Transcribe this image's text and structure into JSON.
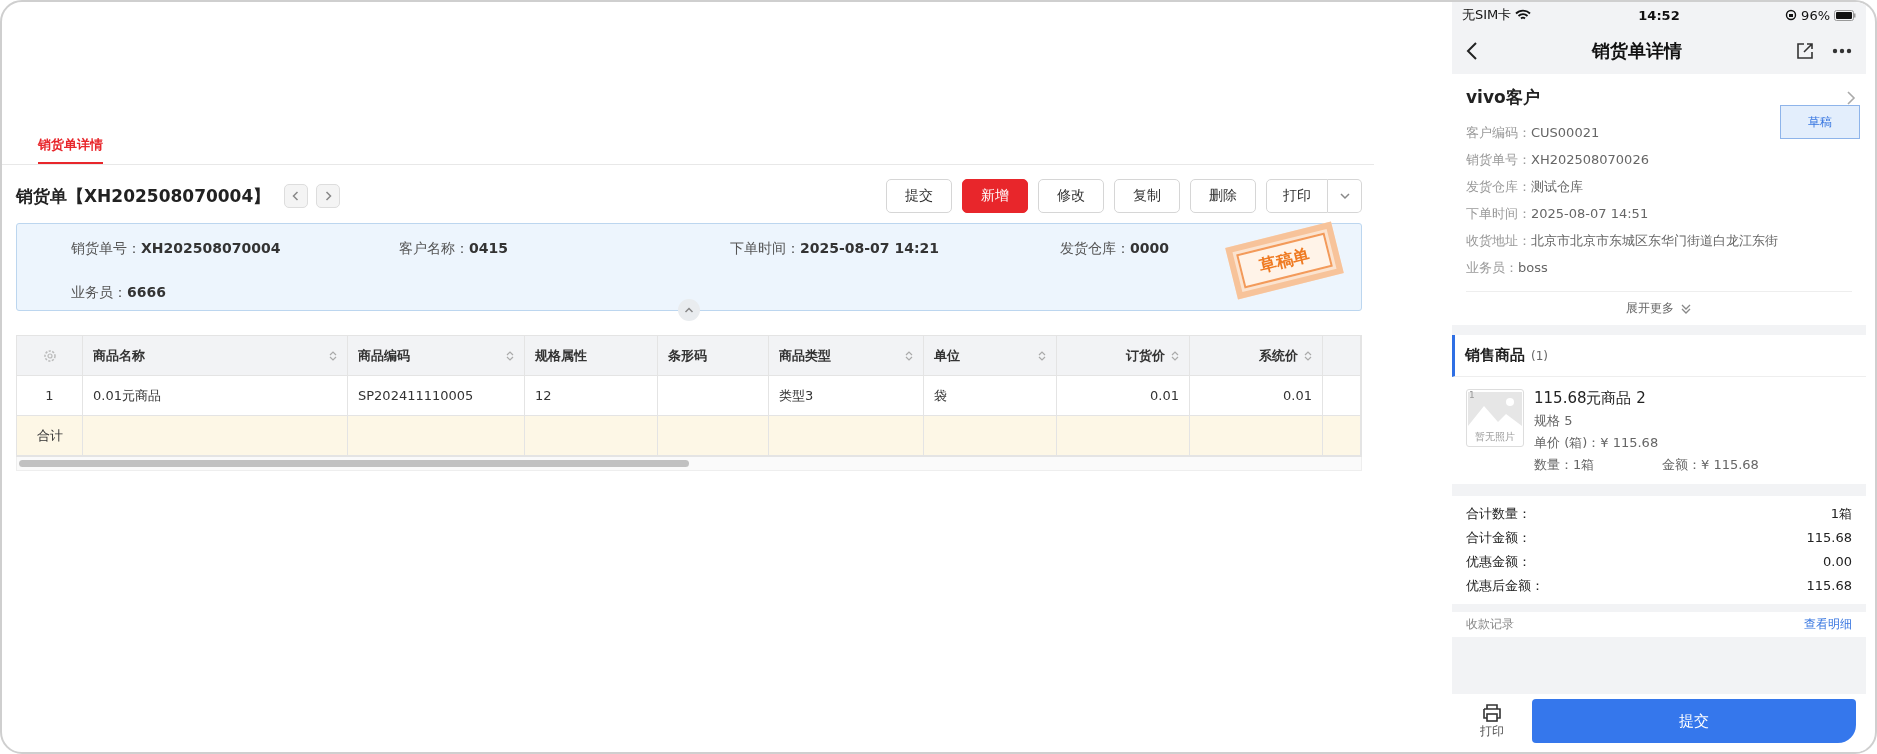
{
  "tabs": [
    {
      "label": "销货单详情",
      "selected": true
    }
  ],
  "order": {
    "title": "销货单【XH202508070004】",
    "actions": [
      {
        "label": "提交",
        "primary": false
      },
      {
        "label": "新增",
        "primary": true
      },
      {
        "label": "修改",
        "primary": false
      },
      {
        "label": "复制",
        "primary": false
      },
      {
        "label": "删除",
        "primary": false
      }
    ],
    "print": "打印"
  },
  "info": {
    "fields": [
      {
        "label": "销货单号：",
        "value": "XH202508070004"
      },
      {
        "label": "客户名称：",
        "value": "0415"
      },
      {
        "label": "下单时间：",
        "value": "2025-08-07 14:21"
      },
      {
        "label": "发货仓库：",
        "value": "0000"
      },
      {
        "label": "业务员：",
        "value": "6666"
      }
    ],
    "stamp": "草稿单"
  },
  "table": {
    "columns": [
      {
        "label": "商品名称",
        "sortable": true,
        "right_aligned": false
      },
      {
        "label": "商品编码",
        "sortable": true,
        "right_aligned": false
      },
      {
        "label": "规格属性",
        "sortable": false,
        "right_aligned": false
      },
      {
        "label": "条形码",
        "sortable": false,
        "right_aligned": false
      },
      {
        "label": "商品类型",
        "sortable": true,
        "right_aligned": false
      },
      {
        "label": "单位",
        "sortable": true,
        "right_aligned": false
      },
      {
        "label": "订货价",
        "sortable": true,
        "right_aligned": true
      },
      {
        "label": "系统价",
        "sortable": true,
        "right_aligned": true
      }
    ],
    "rows": [
      {
        "index": "1",
        "cells": [
          "0.01元商品",
          "SP202411110005",
          "12",
          "",
          "类型3",
          "袋",
          "0.01",
          "0.01"
        ]
      }
    ],
    "total_label": "合计"
  },
  "mobile": {
    "status": {
      "carrier": "无SIM卡",
      "time": "14:52",
      "battery": "96%"
    },
    "title": "销货单详情",
    "customer": "vivo客户",
    "badge": "草稿",
    "fields": [
      {
        "label": "客户编码：",
        "value": "CUS00021"
      },
      {
        "label": "销货单号：",
        "value": "XH202508070026"
      },
      {
        "label": "发货仓库：",
        "value": "测试仓库"
      },
      {
        "label": "下单时间：",
        "value": "2025-08-07 14:51"
      },
      {
        "label": "收货地址：",
        "value": "北京市北京市东城区东华门街道白龙江东街"
      },
      {
        "label": "业务员：",
        "value": "boss"
      }
    ],
    "expand": "展开更多",
    "section": "销售商品",
    "count": "(1)",
    "product": {
      "thumb_index": "1",
      "no_photo": "暂无照片",
      "name": "115.68元商品 2",
      "spec": "规格 5",
      "price": "单价 (箱)：¥ 115.68",
      "qty": "数量：1箱",
      "amount": "金额：¥ 115.68"
    },
    "totals": [
      {
        "label": "合计数量：",
        "value": "1箱"
      },
      {
        "label": "合计金额：",
        "value": "115.68"
      },
      {
        "label": "优惠金额：",
        "value": "0.00"
      },
      {
        "label": "优惠后金额：",
        "value": "115.68"
      }
    ],
    "records": "收款记录",
    "records_link": "查看明细",
    "print": "打印",
    "submit": "提交"
  }
}
